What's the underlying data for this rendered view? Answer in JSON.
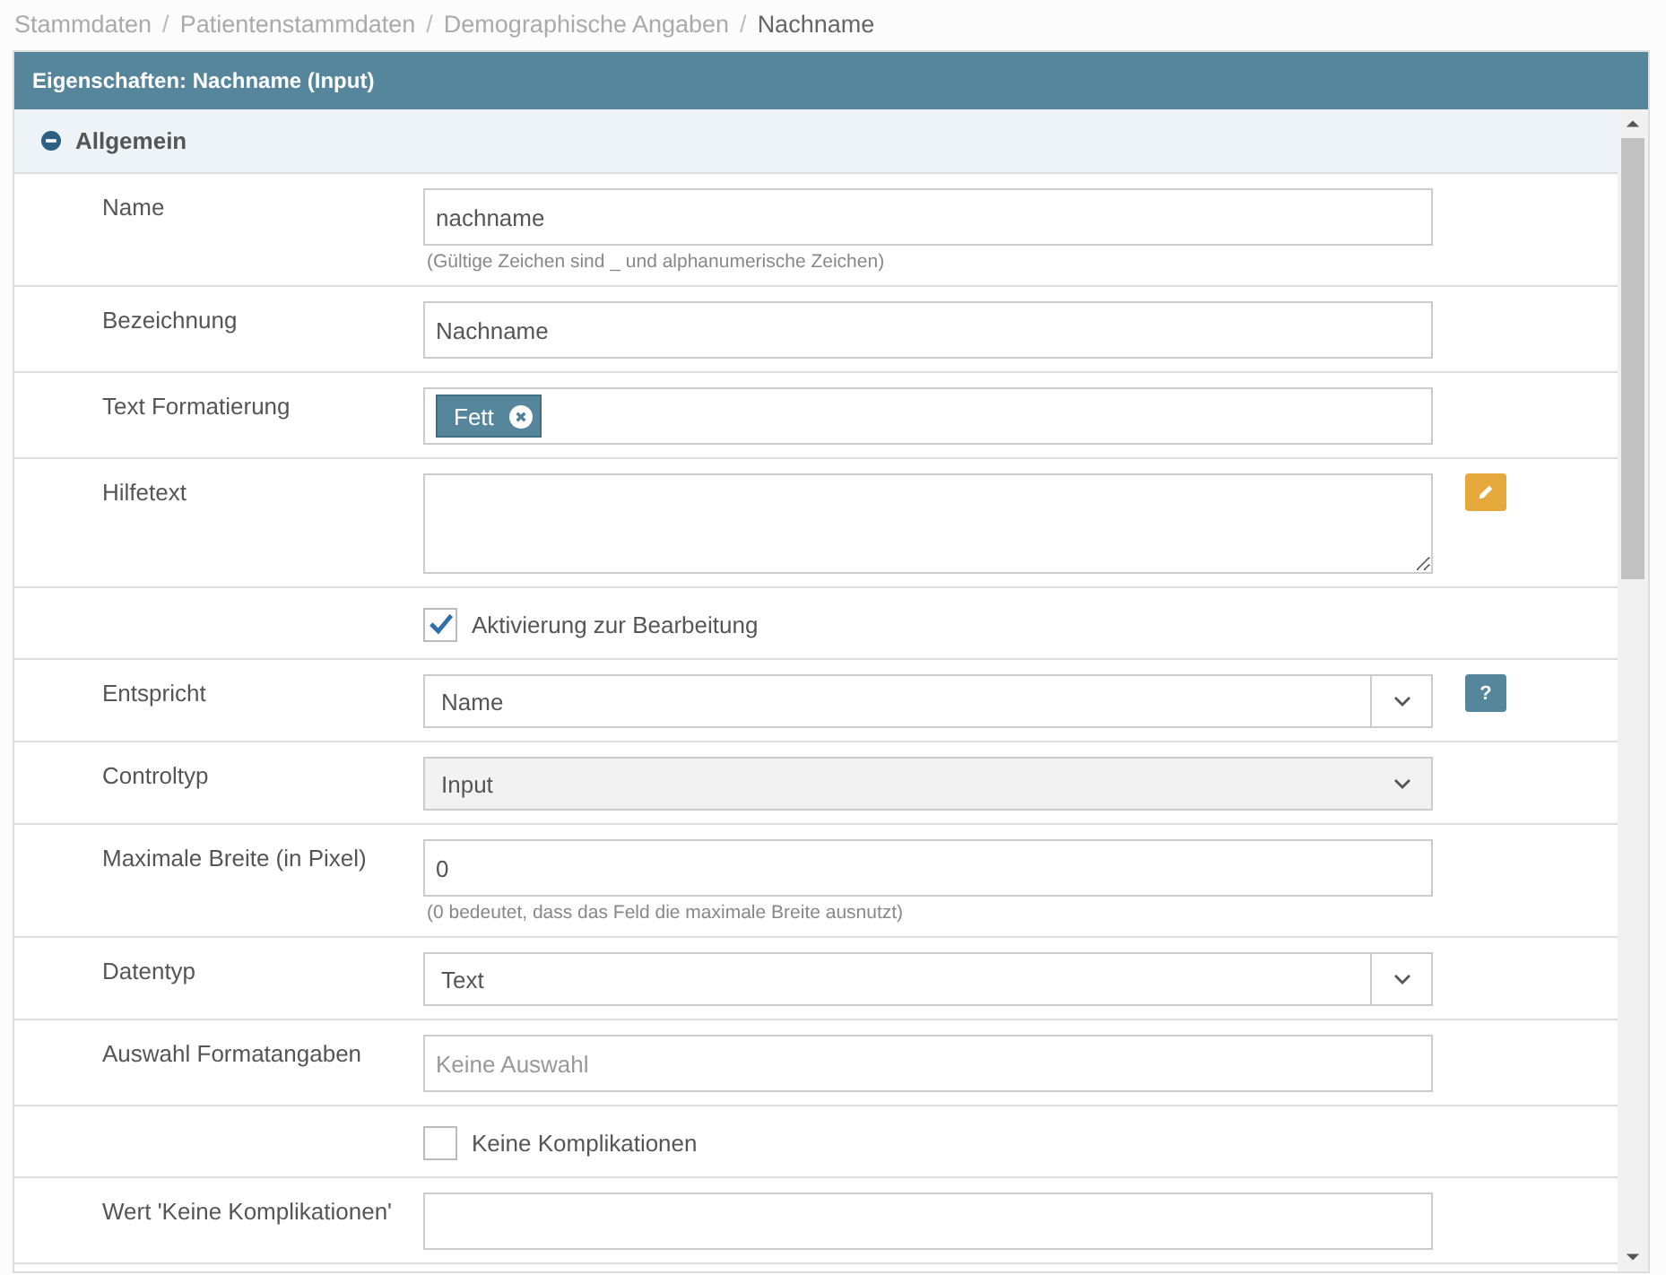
{
  "breadcrumb_separator": "/",
  "breadcrumb": [
    {
      "label": "Stammdaten",
      "current": false
    },
    {
      "label": "Patientenstammdaten",
      "current": false
    },
    {
      "label": "Demographische Angaben",
      "current": false
    },
    {
      "label": "Nachname",
      "current": true
    }
  ],
  "panel": {
    "title": "Eigenschaften: Nachname (Input)",
    "section": {
      "title": "Allgemein",
      "expanded": true
    },
    "rows": [
      {
        "kind": "text",
        "label": "Name",
        "value": "nachname",
        "hint": "(Gültige Zeichen sind _ und alphanumerische Zeichen)"
      },
      {
        "kind": "text",
        "label": "Bezeichnung",
        "value": "Nachname"
      },
      {
        "kind": "tags",
        "label": "Text Formatierung",
        "tags": [
          "Fett"
        ]
      },
      {
        "kind": "textarea",
        "label": "Hilfetext",
        "side_button": {
          "kind": "edit"
        }
      },
      {
        "kind": "checkbox",
        "text": "Aktivierung zur Bearbeitung",
        "checked": true
      },
      {
        "kind": "select",
        "label": "Entspricht",
        "value": "Name",
        "disabled": false,
        "side_button": {
          "kind": "help",
          "text": "?"
        }
      },
      {
        "kind": "select",
        "label": "Controltyp",
        "value": "Input",
        "disabled": true
      },
      {
        "kind": "text",
        "label": "Maximale Breite (in Pixel)",
        "value": "0",
        "hint": "(0 bedeutet, dass das Feld die maximale Breite ausnutzt)"
      },
      {
        "kind": "select",
        "label": "Datentyp",
        "value": "Text",
        "disabled": false
      },
      {
        "kind": "text",
        "label": "Auswahl Formatangaben",
        "placeholder": "Keine Auswahl"
      },
      {
        "kind": "checkbox",
        "text": "Keine Komplikationen",
        "checked": false
      },
      {
        "kind": "text",
        "label": "Wert 'Keine Komplikationen'",
        "value": ""
      }
    ]
  }
}
